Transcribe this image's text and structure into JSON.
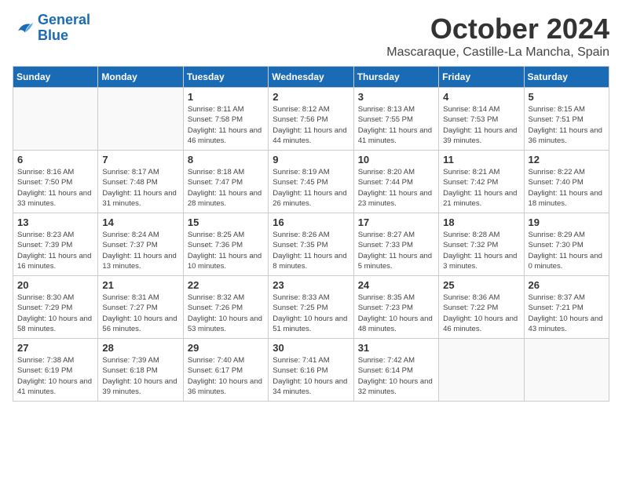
{
  "logo": {
    "line1": "General",
    "line2": "Blue"
  },
  "title": "October 2024",
  "location": "Mascaraque, Castille-La Mancha, Spain",
  "weekdays": [
    "Sunday",
    "Monday",
    "Tuesday",
    "Wednesday",
    "Thursday",
    "Friday",
    "Saturday"
  ],
  "weeks": [
    [
      {
        "day": "",
        "info": ""
      },
      {
        "day": "",
        "info": ""
      },
      {
        "day": "1",
        "info": "Sunrise: 8:11 AM\nSunset: 7:58 PM\nDaylight: 11 hours and 46 minutes."
      },
      {
        "day": "2",
        "info": "Sunrise: 8:12 AM\nSunset: 7:56 PM\nDaylight: 11 hours and 44 minutes."
      },
      {
        "day": "3",
        "info": "Sunrise: 8:13 AM\nSunset: 7:55 PM\nDaylight: 11 hours and 41 minutes."
      },
      {
        "day": "4",
        "info": "Sunrise: 8:14 AM\nSunset: 7:53 PM\nDaylight: 11 hours and 39 minutes."
      },
      {
        "day": "5",
        "info": "Sunrise: 8:15 AM\nSunset: 7:51 PM\nDaylight: 11 hours and 36 minutes."
      }
    ],
    [
      {
        "day": "6",
        "info": "Sunrise: 8:16 AM\nSunset: 7:50 PM\nDaylight: 11 hours and 33 minutes."
      },
      {
        "day": "7",
        "info": "Sunrise: 8:17 AM\nSunset: 7:48 PM\nDaylight: 11 hours and 31 minutes."
      },
      {
        "day": "8",
        "info": "Sunrise: 8:18 AM\nSunset: 7:47 PM\nDaylight: 11 hours and 28 minutes."
      },
      {
        "day": "9",
        "info": "Sunrise: 8:19 AM\nSunset: 7:45 PM\nDaylight: 11 hours and 26 minutes."
      },
      {
        "day": "10",
        "info": "Sunrise: 8:20 AM\nSunset: 7:44 PM\nDaylight: 11 hours and 23 minutes."
      },
      {
        "day": "11",
        "info": "Sunrise: 8:21 AM\nSunset: 7:42 PM\nDaylight: 11 hours and 21 minutes."
      },
      {
        "day": "12",
        "info": "Sunrise: 8:22 AM\nSunset: 7:40 PM\nDaylight: 11 hours and 18 minutes."
      }
    ],
    [
      {
        "day": "13",
        "info": "Sunrise: 8:23 AM\nSunset: 7:39 PM\nDaylight: 11 hours and 16 minutes."
      },
      {
        "day": "14",
        "info": "Sunrise: 8:24 AM\nSunset: 7:37 PM\nDaylight: 11 hours and 13 minutes."
      },
      {
        "day": "15",
        "info": "Sunrise: 8:25 AM\nSunset: 7:36 PM\nDaylight: 11 hours and 10 minutes."
      },
      {
        "day": "16",
        "info": "Sunrise: 8:26 AM\nSunset: 7:35 PM\nDaylight: 11 hours and 8 minutes."
      },
      {
        "day": "17",
        "info": "Sunrise: 8:27 AM\nSunset: 7:33 PM\nDaylight: 11 hours and 5 minutes."
      },
      {
        "day": "18",
        "info": "Sunrise: 8:28 AM\nSunset: 7:32 PM\nDaylight: 11 hours and 3 minutes."
      },
      {
        "day": "19",
        "info": "Sunrise: 8:29 AM\nSunset: 7:30 PM\nDaylight: 11 hours and 0 minutes."
      }
    ],
    [
      {
        "day": "20",
        "info": "Sunrise: 8:30 AM\nSunset: 7:29 PM\nDaylight: 10 hours and 58 minutes."
      },
      {
        "day": "21",
        "info": "Sunrise: 8:31 AM\nSunset: 7:27 PM\nDaylight: 10 hours and 56 minutes."
      },
      {
        "day": "22",
        "info": "Sunrise: 8:32 AM\nSunset: 7:26 PM\nDaylight: 10 hours and 53 minutes."
      },
      {
        "day": "23",
        "info": "Sunrise: 8:33 AM\nSunset: 7:25 PM\nDaylight: 10 hours and 51 minutes."
      },
      {
        "day": "24",
        "info": "Sunrise: 8:35 AM\nSunset: 7:23 PM\nDaylight: 10 hours and 48 minutes."
      },
      {
        "day": "25",
        "info": "Sunrise: 8:36 AM\nSunset: 7:22 PM\nDaylight: 10 hours and 46 minutes."
      },
      {
        "day": "26",
        "info": "Sunrise: 8:37 AM\nSunset: 7:21 PM\nDaylight: 10 hours and 43 minutes."
      }
    ],
    [
      {
        "day": "27",
        "info": "Sunrise: 7:38 AM\nSunset: 6:19 PM\nDaylight: 10 hours and 41 minutes."
      },
      {
        "day": "28",
        "info": "Sunrise: 7:39 AM\nSunset: 6:18 PM\nDaylight: 10 hours and 39 minutes."
      },
      {
        "day": "29",
        "info": "Sunrise: 7:40 AM\nSunset: 6:17 PM\nDaylight: 10 hours and 36 minutes."
      },
      {
        "day": "30",
        "info": "Sunrise: 7:41 AM\nSunset: 6:16 PM\nDaylight: 10 hours and 34 minutes."
      },
      {
        "day": "31",
        "info": "Sunrise: 7:42 AM\nSunset: 6:14 PM\nDaylight: 10 hours and 32 minutes."
      },
      {
        "day": "",
        "info": ""
      },
      {
        "day": "",
        "info": ""
      }
    ]
  ]
}
